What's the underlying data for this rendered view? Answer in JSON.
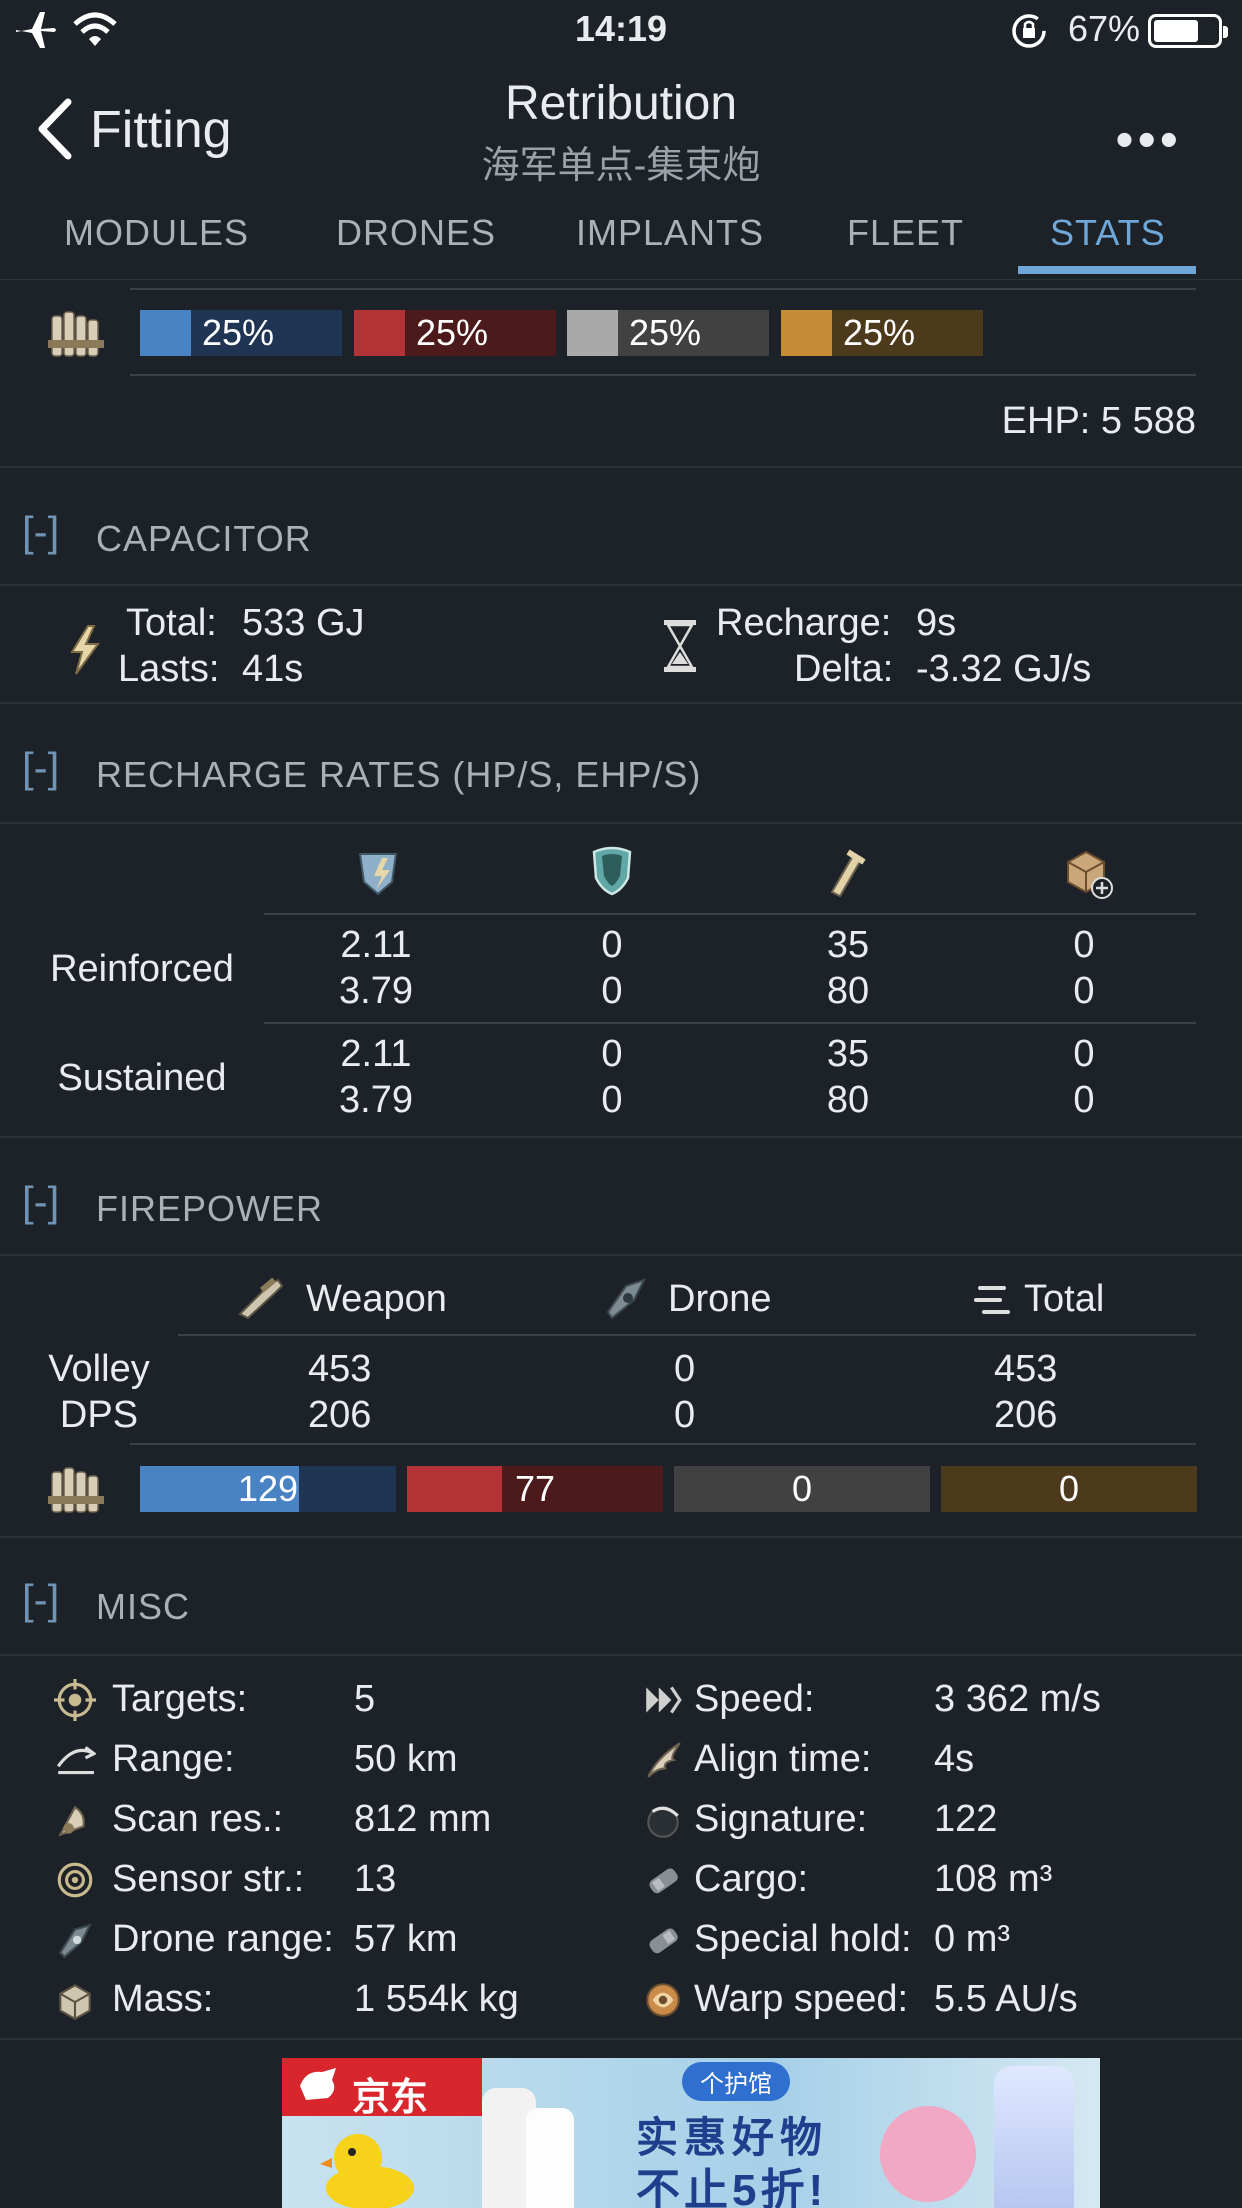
{
  "status_bar": {
    "time": "14:19",
    "battery_percent": "67%"
  },
  "nav": {
    "back_label": "Fitting",
    "title": "Retribution",
    "subtitle": "海军单点-集束炮",
    "more": "•••"
  },
  "tabs": [
    {
      "label": "MODULES"
    },
    {
      "label": "DRONES"
    },
    {
      "label": "IMPLANTS"
    },
    {
      "label": "FLEET"
    },
    {
      "label": "STATS",
      "active": true
    }
  ],
  "resists": {
    "bars": [
      {
        "label": "25%",
        "fraction": 0.25,
        "color": "#4a83c4",
        "bg": "#203553"
      },
      {
        "label": "25%",
        "fraction": 0.25,
        "color": "#b23235",
        "bg": "#4d1a1c"
      },
      {
        "label": "25%",
        "fraction": 0.25,
        "color": "#a9a9a9",
        "bg": "#414141"
      },
      {
        "label": "25%",
        "fraction": 0.25,
        "color": "#c48c34",
        "bg": "#4d3a1c"
      }
    ],
    "ehp": "EHP: 5 588"
  },
  "capacitor": {
    "bracket": "[-]",
    "title": "CAPACITOR",
    "total_label": "Total:",
    "total_value": "533 GJ",
    "lasts_label": "Lasts:",
    "lasts_value": "41s",
    "recharge_label": "Recharge:",
    "recharge_value": "9s",
    "delta_label": "Delta:",
    "delta_value": "-3.32 GJ/s"
  },
  "recharge_rates": {
    "bracket": "[-]",
    "title": "RECHARGE RATES (HP/S, EHP/S)",
    "columns": [
      "shield-booster-icon",
      "shield-recharge-icon",
      "armor-repair-icon",
      "hull-repair-icon"
    ],
    "rows": [
      {
        "label": "Reinforced",
        "hp": [
          "2.11",
          "0",
          "35",
          "0"
        ],
        "ehp": [
          "3.79",
          "0",
          "80",
          "0"
        ]
      },
      {
        "label": "Sustained",
        "hp": [
          "2.11",
          "0",
          "35",
          "0"
        ],
        "ehp": [
          "3.79",
          "0",
          "80",
          "0"
        ]
      }
    ]
  },
  "firepower": {
    "bracket": "[-]",
    "title": "FIREPOWER",
    "headers": [
      "Weapon",
      "Drone",
      "Total"
    ],
    "rows": [
      {
        "label": "Volley",
        "values": [
          "453",
          "0",
          "453"
        ]
      },
      {
        "label": "DPS",
        "values": [
          "206",
          "0",
          "206"
        ]
      }
    ],
    "damage_bars": [
      {
        "label": "129",
        "fraction": 0.62,
        "color": "#4a83c4",
        "bg": "#203553"
      },
      {
        "label": "77",
        "fraction": 0.37,
        "color": "#b23235",
        "bg": "#4d1a1c"
      },
      {
        "label": "0",
        "fraction": 0,
        "color": "#a9a9a9",
        "bg": "#414141"
      },
      {
        "label": "0",
        "fraction": 0,
        "color": "#c48c34",
        "bg": "#4d3a1c"
      }
    ]
  },
  "misc": {
    "bracket": "[-]",
    "title": "MISC",
    "left": [
      {
        "label": "Targets:",
        "value": "5",
        "icon": "targets-icon"
      },
      {
        "label": "Range:",
        "value": "50 km",
        "icon": "range-icon"
      },
      {
        "label": "Scan res.:",
        "value": "812 mm",
        "icon": "scan-res-icon"
      },
      {
        "label": "Sensor str.:",
        "value": "13",
        "icon": "sensor-strength-icon"
      },
      {
        "label": "Drone range:",
        "value": "57 km",
        "icon": "drone-range-icon"
      },
      {
        "label": "Mass:",
        "value": "1 554k kg",
        "icon": "mass-icon"
      }
    ],
    "right": [
      {
        "label": "Speed:",
        "value": "3 362 m/s",
        "icon": "speed-icon"
      },
      {
        "label": "Align time:",
        "value": "4s",
        "icon": "align-time-icon"
      },
      {
        "label": "Signature:",
        "value": "122",
        "icon": "signature-icon"
      },
      {
        "label": "Cargo:",
        "value": "108 m³",
        "icon": "cargo-icon"
      },
      {
        "label": "Special hold:",
        "value": "0 m³",
        "icon": "special-hold-icon"
      },
      {
        "label": "Warp speed:",
        "value": "5.5 AU/s",
        "icon": "warp-speed-icon"
      }
    ]
  },
  "ad": {
    "brand": "京东",
    "tag": "个护馆",
    "line1": "实惠好物",
    "line2": "不止5折!"
  }
}
